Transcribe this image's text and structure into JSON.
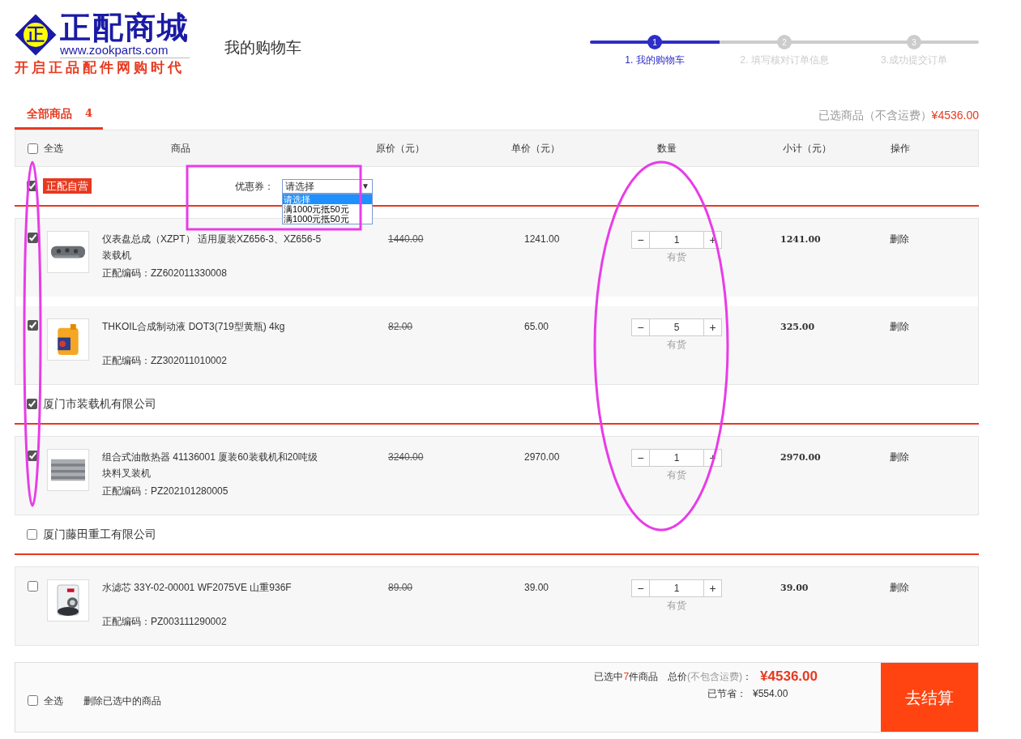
{
  "logo": {
    "badge": "正",
    "title": "正配商城",
    "url": "www.zookparts.com",
    "slogan": "开启正品配件网购时代"
  },
  "page_title": "我的购物车",
  "steps": [
    {
      "number": "1",
      "label": "1. 我的购物车",
      "selected": true
    },
    {
      "number": "2",
      "label": "2. 填写核对订单信息",
      "selected": false
    },
    {
      "number": "3",
      "label": "3.成功提交订单",
      "selected": false
    }
  ],
  "tab": {
    "label": "全部商品",
    "count": "4"
  },
  "selected_summary": {
    "label": "已选商品（不含运费）",
    "amount": "¥4536.00"
  },
  "table": {
    "select_all": {
      "label": "全选",
      "checked": false
    },
    "columns": [
      "商品",
      "原价（元）",
      "单价（元）",
      "数量",
      "小计（元）",
      "操作"
    ]
  },
  "groups": [
    {
      "kind": "badge",
      "name": "正配自营",
      "checked": true,
      "coupon": {
        "label": "优惠券：",
        "value": "请选择",
        "arrow": "▼",
        "options": [
          {
            "label": "请选择",
            "selected": true
          },
          {
            "label": "满1000元抵50元",
            "selected": false
          },
          {
            "label": "满1000元抵50元",
            "selected": false
          }
        ]
      },
      "items": [
        {
          "checked": true,
          "name": "仪表盘总成（XZPT） 适用厦装XZ656-3、XZ656-5装载机",
          "code": "正配编码：ZZ602011330008",
          "original_price": "1440.00",
          "unit_price": "1241.00",
          "decrease": "−",
          "quantity": "1",
          "increase": "+",
          "stock": "有货",
          "subtotal": "1241.00",
          "action": "删除"
        },
        {
          "checked": true,
          "name": "THKOIL合成制动液 DOT3(719型黄瓶) 4kg",
          "code": "正配编码：ZZ302011010002",
          "original_price": "82.00",
          "unit_price": "65.00",
          "decrease": "−",
          "quantity": "5",
          "increase": "+",
          "stock": "有货",
          "subtotal": "325.00",
          "action": "删除"
        }
      ]
    },
    {
      "kind": "plain",
      "name": "厦门市装载机有限公司",
      "checked": true,
      "items": [
        {
          "checked": true,
          "name": "组合式油散热器 41136001 厦装60装载机和20吨级块料叉装机",
          "code": "正配编码：PZ202101280005",
          "original_price": "3240.00",
          "unit_price": "2970.00",
          "decrease": "−",
          "quantity": "1",
          "increase": "+",
          "stock": "有货",
          "subtotal": "2970.00",
          "action": "删除"
        }
      ]
    },
    {
      "kind": "plain",
      "name": "厦门藤田重工有限公司",
      "checked": false,
      "items": [
        {
          "checked": false,
          "name": "水滤芯 33Y-02-00001 WF2075VE 山重936F",
          "code": "正配编码：PZ003111290002",
          "original_price": "89.00",
          "unit_price": "39.00",
          "decrease": "−",
          "quantity": "1",
          "increase": "+",
          "stock": "有货",
          "subtotal": "39.00",
          "action": "删除"
        }
      ]
    }
  ],
  "footer": {
    "select_all": {
      "label": "全选",
      "checked": false
    },
    "delete_selected": "删除已选中的商品",
    "selected_prefix": "已选中",
    "selected_count": "7",
    "selected_suffix": "件商品",
    "total_label": "总价",
    "total_note": "(不包含运费)",
    "total_colon": "：",
    "total": "¥4536.00",
    "saved_label": "已节省：",
    "saved": "¥554.00",
    "checkout": "去结算"
  },
  "annotations": [
    {
      "kind": "rectangle"
    },
    {
      "kind": "ellipse"
    },
    {
      "kind": "ellipse"
    }
  ]
}
